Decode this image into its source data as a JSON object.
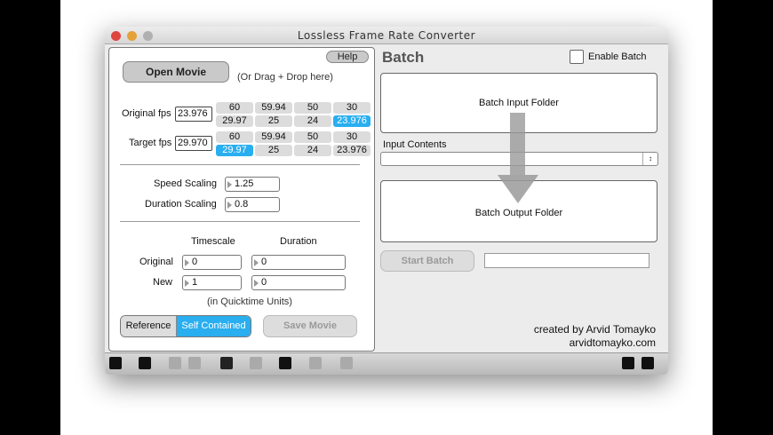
{
  "window": {
    "title": "Lossless Frame Rate Converter"
  },
  "left": {
    "help": "Help",
    "open_movie": "Open Movie",
    "drag_hint": "(Or Drag + Drop here)",
    "original_fps": {
      "label": "Original fps",
      "value": "23.976",
      "presets": [
        "60",
        "59.94",
        "50",
        "30",
        "29.97",
        "25",
        "24",
        "23.976"
      ],
      "selected": "23.976"
    },
    "target_fps": {
      "label": "Target fps",
      "value": "29.970",
      "presets": [
        "60",
        "59.94",
        "50",
        "30",
        "29.97",
        "25",
        "24",
        "23.976"
      ],
      "selected": "29.97"
    },
    "speed_scaling": {
      "label": "Speed Scaling",
      "value": "1.25"
    },
    "duration_scaling": {
      "label": "Duration Scaling",
      "value": "0.8"
    },
    "col_timescale": "Timescale",
    "col_duration": "Duration",
    "row_original": {
      "label": "Original",
      "timescale": "0",
      "duration": "0"
    },
    "row_new": {
      "label": "New",
      "timescale": "1",
      "duration": "0"
    },
    "units_note": "(in Quicktime Units)",
    "mode_reference": "Reference",
    "mode_self_contained": "Self Contained",
    "save_movie": "Save Movie"
  },
  "right": {
    "title": "Batch",
    "enable_batch": "Enable Batch",
    "input_folder": "Batch Input Folder",
    "input_contents_label": "Input Contents",
    "input_contents_value": "",
    "output_folder": "Batch Output Folder",
    "start_batch": "Start Batch",
    "credit1": "created by Arvid Tomayko",
    "credit2": "arvidtomayko.com"
  },
  "colors": {
    "accent": "#29aef0"
  }
}
